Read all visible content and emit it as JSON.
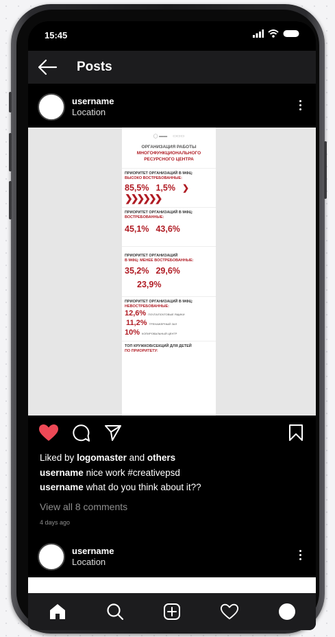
{
  "status": {
    "time": "15:45"
  },
  "header": {
    "title": "Posts"
  },
  "post1": {
    "username": "username",
    "location": "Location"
  },
  "poster": {
    "org_line1": "ОРГАНИЗАЦИЯ РАБОТЫ",
    "org_line2": "МНОГОФУНКЦИОНАЛЬНОГО",
    "org_line3": "РЕСУРСНОГО ЦЕНТРА",
    "sec1_title": "ПРИОРИТЕТ ОРГАНИЗАЦИЙ В МФЦ:",
    "sec1_sub": "ВЫСОКО ВОСТРЕБОВАННЫЕ:",
    "sec1_val1": "85,5%",
    "sec1_val2": "1,5%",
    "sec2_title": "ПРИОРИТЕТ ОРГАНИЗАЦИЙ В МФЦ:",
    "sec2_sub": "ВОСТРЕБОВАННЫЕ:",
    "sec2_val1": "45,1%",
    "sec2_val2": "43,6%",
    "sec3_title": "ПРИОРИТЕТ ОРГАНИЗАЦИЙ",
    "sec3_sub": "В МФЦ: МЕНЕЕ ВОСТРЕБОВАННЫЕ:",
    "sec3_val1": "35,2%",
    "sec3_val2": "29,6%",
    "sec3_val3": "23,9%",
    "sec4_title": "ПРИОРИТЕТ ОРГАНИЗАЦИЙ В МФЦ:",
    "sec4_sub": "НЕВОСТРЕБОВАННЫЕ:",
    "sec4_r1": "12,6%",
    "sec4_r1_label": "ПОЧТА/ПОЧТОВЫЕ ЯЩИКИ",
    "sec4_r2": "11,2%",
    "sec4_r2_label": "ТРЕНАЖЕРНЫЙ ЗАЛ",
    "sec4_r3": "10%",
    "sec4_r3_label": "КОПИРОВАЛЬНЫЙ ЦЕНТР",
    "sec5_title": "ТОП КРУЖКОВ/СЕКЦИЙ ДЛЯ ДЕТЕЙ",
    "sec5_sub": "ПО ПРИОРИТЕТУ:"
  },
  "engagement": {
    "liked_prefix": "Liked by",
    "liked_user": "logomaster",
    "liked_and": "and",
    "liked_others": "others",
    "c1_user": "username",
    "c1_text": "nice work #creativepsd",
    "c2_user": "username",
    "c2_text": "what do you think about it??",
    "view_all": "View all 8 comments",
    "time_ago": "4 days ago"
  },
  "post2": {
    "username": "username",
    "location": "Location"
  },
  "colors": {
    "like": "#ed4956",
    "accent": "#b01c24"
  }
}
